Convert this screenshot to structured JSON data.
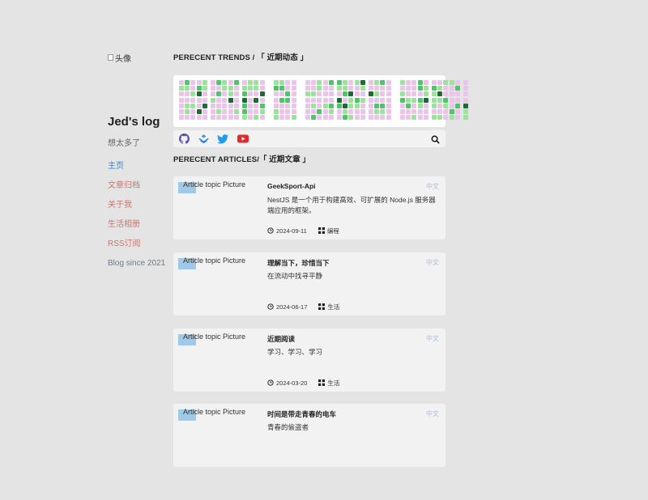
{
  "sidebar": {
    "avatar_alt": "头像",
    "title": "Jed's log",
    "subtitle": "想太多了",
    "nav": [
      {
        "label": "主页"
      },
      {
        "label": "文章归档"
      },
      {
        "label": "关于我"
      },
      {
        "label": "生活相册"
      },
      {
        "label": "RSS订阅"
      },
      {
        "label": "Blog since 2021"
      }
    ]
  },
  "trends": {
    "title": "PERECENT TRENDS / 「 近期动态 」"
  },
  "toolbar": {
    "icons": [
      "github-icon",
      "juejin-icon",
      "twitter-icon",
      "youtube-icon"
    ],
    "search_icon": "search-icon"
  },
  "articles": {
    "title": "PERECENT ARTICLES/「 近期文章 」",
    "image_alt": "Article topic Picture",
    "items": [
      {
        "title": "GeekSport-Api",
        "lang": "中文",
        "desc": "NestJS 是一个用于构建高效、可扩展的 Node.js 服务器端应用的框架。",
        "date": "2024-09-11",
        "category": "编程"
      },
      {
        "title": "理解当下，珍惜当下",
        "lang": "中文",
        "desc": "在流动中找寻平静",
        "date": "2024-06-17",
        "category": "生活"
      },
      {
        "title": "近期阅读",
        "lang": "中文",
        "desc": "学习、学习、学习",
        "date": "2024-03-20",
        "category": "生活"
      },
      {
        "title": "时间是带走青春的电车",
        "lang": "中文",
        "desc": "青春的偷盗者",
        "date": "",
        "category": ""
      }
    ]
  },
  "colors": {
    "accent": "#3b82c4",
    "link": "#c9756f",
    "pink": "#ebc4ea",
    "green_light": "#9be39b",
    "green_mid": "#4fc46a",
    "green_dark": "#1d6b33"
  }
}
